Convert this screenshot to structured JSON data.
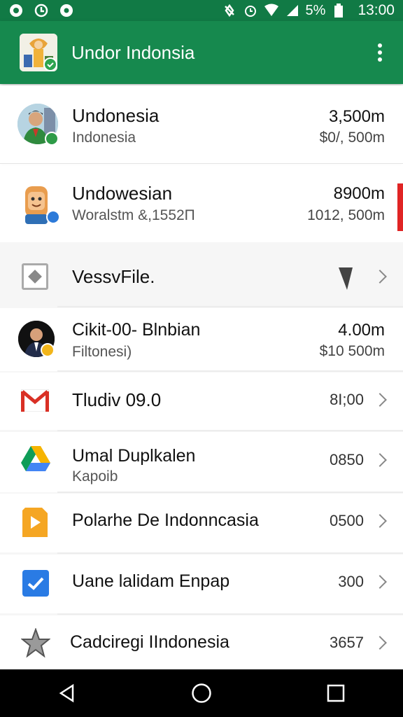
{
  "status_bar": {
    "battery": "5%",
    "time": "13:00"
  },
  "app_bar": {
    "title": "Undor Indonsia",
    "menu_icon": "more-vert-icon"
  },
  "top_cards": [
    {
      "title": "Undonesia",
      "subtitle": "Indonesia",
      "value": "3,500m",
      "subvalue": "$0/, 500m"
    },
    {
      "title": "Undowesian",
      "subtitle": "Woralstm &,1552П",
      "value": "8900m",
      "subvalue": "1012, 500m"
    }
  ],
  "list": [
    {
      "title": "VessvFile.",
      "subtitle": "",
      "value": "",
      "icon": "file-icon"
    },
    {
      "title": "Cikit-00- Blnbian",
      "subtitle": "Filtonesi)",
      "value": "4.00m",
      "subvalue": "$10 500m",
      "icon": "person-avatar"
    },
    {
      "title": "Tludiv 09.0",
      "subtitle": "",
      "value": "8I;00",
      "icon": "gmail-icon"
    },
    {
      "title": "Umal Duplkalen",
      "subtitle": "Kapoib",
      "value": "0850",
      "icon": "drive-icon"
    },
    {
      "title": "Polarhe De Indonncasia",
      "subtitle": "",
      "value": "0500",
      "icon": "play-icon"
    },
    {
      "title": "Uane lalidam Enpap",
      "subtitle": "",
      "value": "300",
      "icon": "check-icon"
    },
    {
      "title": "Cadciregi IIndonesia",
      "subtitle": "",
      "value": "3657",
      "icon": "star-icon"
    }
  ],
  "colors": {
    "appbar": "#16894e",
    "statusbar": "#117a45",
    "accent_red": "#e02424"
  }
}
